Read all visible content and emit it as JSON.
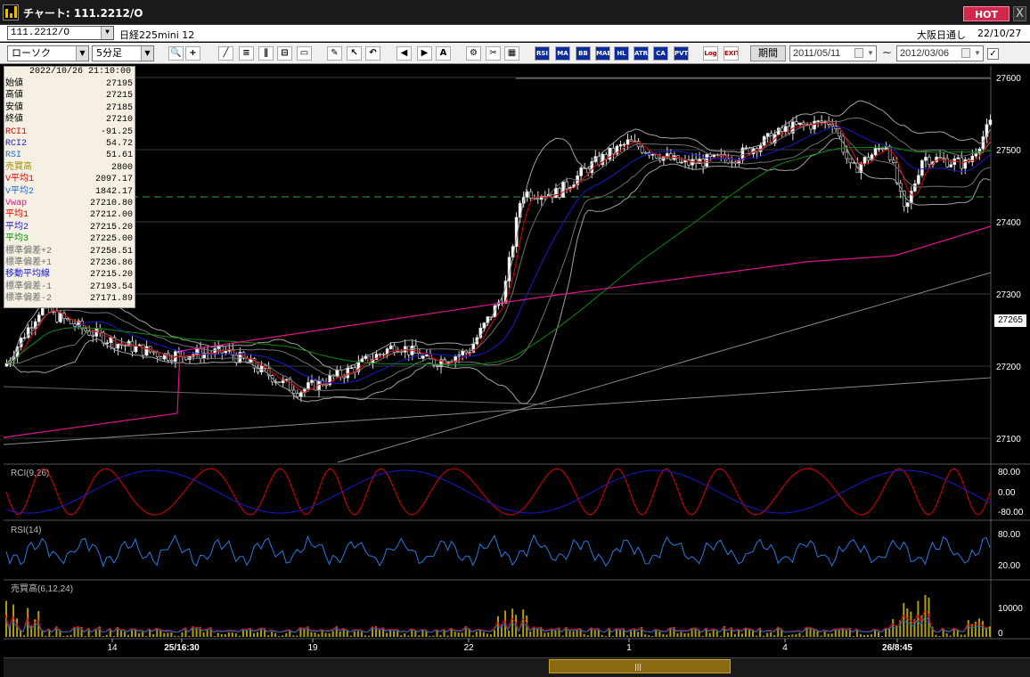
{
  "window": {
    "title": "チャート: 111.2212/O",
    "hot_label": "HOT",
    "close_label": "X"
  },
  "header": {
    "symbol": "111.2212/O",
    "instrument": "日経225mini 12",
    "session": "大阪日通し",
    "date": "22/10/27"
  },
  "toolbar": {
    "chart_type": "ローソク",
    "interval": "5分足",
    "buttons": [
      "zoom-icon",
      "crosshair-icon",
      "trend-icon",
      "fibo-icon",
      "parallel-icon",
      "split-icon",
      "eraser-icon",
      "pen-icon",
      "cursor-icon",
      "undo-icon",
      "bar-left-icon",
      "bar-right-icon",
      "all-icon",
      "settings-icon",
      "tools-icon",
      "palette-icon"
    ],
    "indicator_buttons": [
      "RSI",
      "MA",
      "BB",
      "MAE",
      "HL",
      "ATR",
      "CA",
      "PVT",
      "Log",
      "EXIT"
    ],
    "period_label": "期間",
    "from_date": "2011/05/11",
    "to_date": "2012/03/06",
    "tilde": "~",
    "checkbox": "✓"
  },
  "data_window": {
    "datetime": "2022/10/26  21:10:00",
    "rows": [
      {
        "label": "始値",
        "value": "27195",
        "color": "#000000"
      },
      {
        "label": "高値",
        "value": "27215",
        "color": "#000000"
      },
      {
        "label": "安値",
        "value": "27185",
        "color": "#000000"
      },
      {
        "label": "終値",
        "value": "27210",
        "color": "#000000"
      },
      {
        "label": "RCI1",
        "value": "-91.25",
        "color": "#e00000"
      },
      {
        "label": "RCI2",
        "value": "54.72",
        "color": "#1a1acc"
      },
      {
        "label": "RSI",
        "value": "51.61",
        "color": "#1a6ad0"
      },
      {
        "label": "売買高",
        "value": "2800",
        "color": "#a09000"
      },
      {
        "label": "V平均1",
        "value": "2097.17",
        "color": "#e00000"
      },
      {
        "label": "V平均2",
        "value": "1842.17",
        "color": "#1a6ad0"
      },
      {
        "label": "Vwap",
        "value": "27210.80",
        "color": "#e0148c"
      },
      {
        "label": "平均1",
        "value": "27212.00",
        "color": "#e00000"
      },
      {
        "label": "平均2",
        "value": "27215.20",
        "color": "#1a1acc"
      },
      {
        "label": "平均3",
        "value": "27225.00",
        "color": "#0a8a0a"
      },
      {
        "label": "標準偏差+2",
        "value": "27258.51",
        "color": "#707070"
      },
      {
        "label": "標準偏差+1",
        "value": "27236.86",
        "color": "#707070"
      },
      {
        "label": "移動平均線",
        "value": "27215.20",
        "color": "#1a1acc"
      },
      {
        "label": "標準偏差-1",
        "value": "27193.54",
        "color": "#707070"
      },
      {
        "label": "標準偏差-2",
        "value": "27171.89",
        "color": "#707070"
      }
    ]
  },
  "price_axis": {
    "ticks": [
      "27600",
      "27500",
      "27400",
      "27300",
      "27200",
      "27100"
    ],
    "current_price": "27265"
  },
  "panes": {
    "rci": {
      "label": "RCI(9,26)",
      "ticks": [
        "80.00",
        "0.00",
        "-80.00"
      ]
    },
    "rsi": {
      "label": "RSI(14)",
      "ticks": [
        "80.00",
        "20.00"
      ]
    },
    "volume": {
      "label": "売買高(6,12,24)",
      "ticks": [
        "10000",
        "0"
      ]
    }
  },
  "time_axis": {
    "ticks": [
      "14",
      "25/16:30",
      "19",
      "22",
      "1",
      "4",
      "26/8:45"
    ]
  },
  "colors": {
    "background": "#000000",
    "up_candle": "#ffffff",
    "down_candle": "#000000",
    "ma_short": "#e00000",
    "ma_mid": "#1a1acc",
    "ma_long": "#0a8a0a",
    "vwap": "#e0148c",
    "bollinger": "#a0a0a0",
    "volume_bar": "#b0a000"
  }
}
